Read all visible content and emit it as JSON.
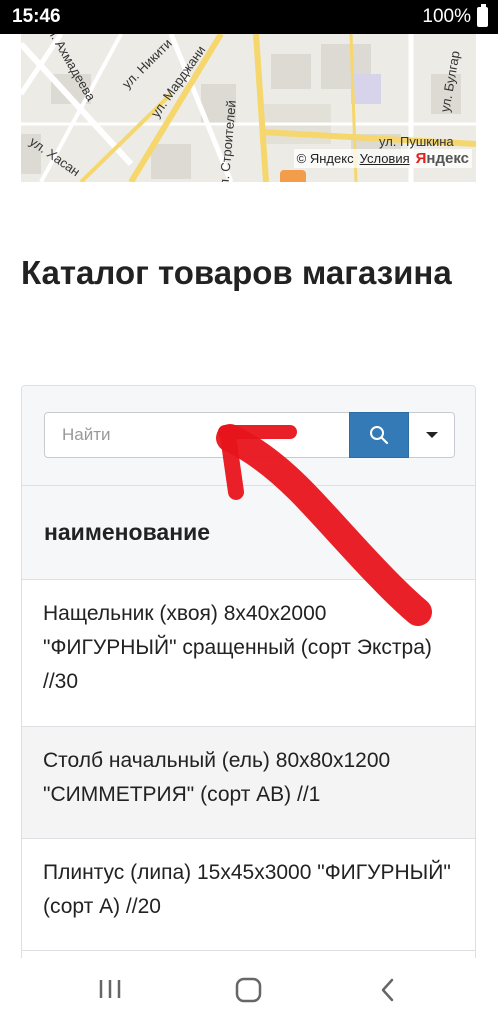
{
  "status_bar": {
    "time": "15:46",
    "battery": "100%"
  },
  "map": {
    "streets": [
      "ул. Ахмадеева",
      "ул. Никити",
      "ул. Марджани",
      "ул. Строителей",
      "ул. Булгар",
      "ул. Хасан",
      "ул. Пушкина"
    ],
    "copyright": "© Яндекс",
    "terms": "Условия",
    "logo_first": "Я",
    "logo_rest": "ндекс"
  },
  "page": {
    "title": "Каталог товаров магазина"
  },
  "search": {
    "placeholder": "Найти",
    "value": ""
  },
  "table": {
    "column_header": "наименование",
    "rows": [
      "Нащельник (хвоя) 8х40х2000 \"ФИГУРНЫЙ\" сращенный (сорт Экстра) //30",
      "Столб начальный (ель) 80х80х1200 \"СИММЕТРИЯ\" (сорт АВ) //1",
      "Плинтус (липа) 15х45х3000 \"ФИГУРНЫЙ\" (сорт А) //20"
    ]
  },
  "colors": {
    "accent": "#337ab7",
    "annotation": "#e8141b"
  },
  "icons": {
    "search": "search-icon",
    "dropdown": "caret-down-icon",
    "nav_recent": "recent-apps-icon",
    "nav_home": "home-icon",
    "nav_back": "back-icon"
  }
}
